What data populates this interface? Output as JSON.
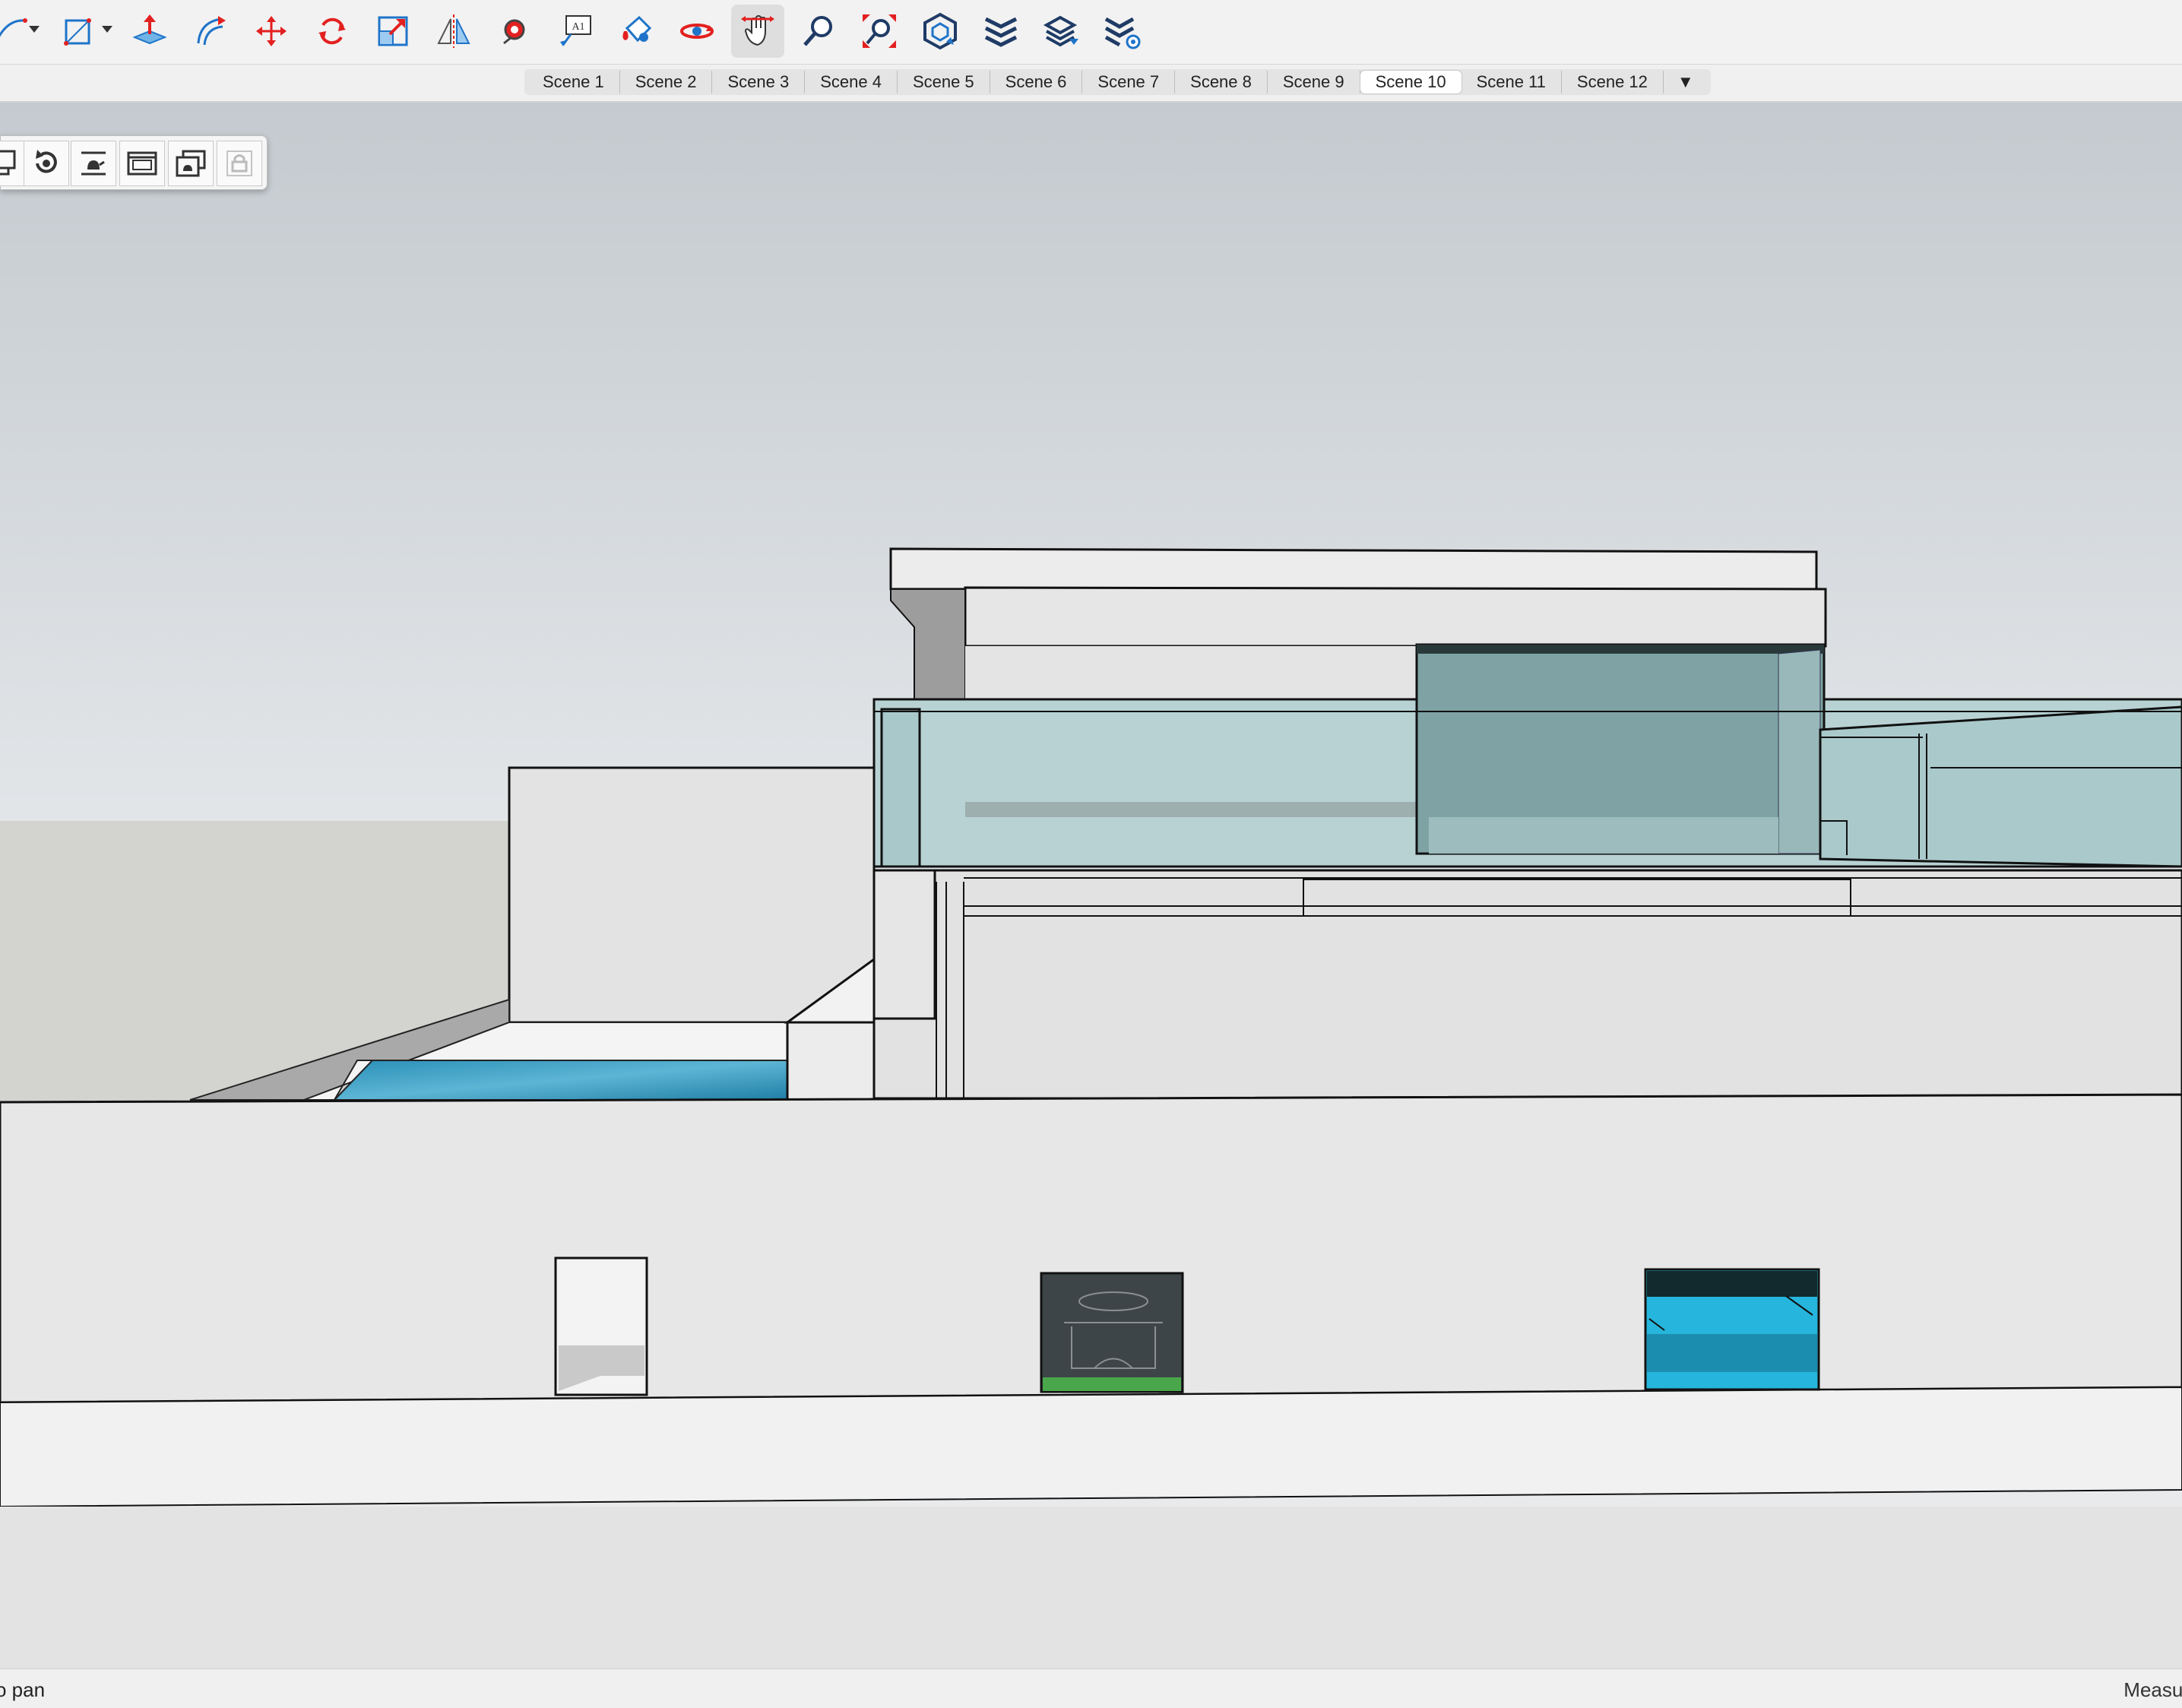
{
  "toolbar": {
    "tools": [
      {
        "name": "arc",
        "icon": "arc-pencil-icon"
      },
      {
        "name": "shapes",
        "icon": "rectangle-shape-icon"
      },
      {
        "name": "push-pull",
        "icon": "push-pull-icon"
      },
      {
        "name": "offset",
        "icon": "offset-icon"
      },
      {
        "name": "move",
        "icon": "move-icon"
      },
      {
        "name": "rotate",
        "icon": "rotate-icon"
      },
      {
        "name": "scale",
        "icon": "scale-icon"
      },
      {
        "name": "flip",
        "icon": "flip-icon"
      },
      {
        "name": "tape-measure",
        "icon": "tape-measure-icon"
      },
      {
        "name": "text",
        "icon": "text-tag-icon"
      },
      {
        "name": "paint-bucket",
        "icon": "paint-bucket-icon"
      },
      {
        "name": "orbit",
        "icon": "orbit-icon"
      },
      {
        "name": "pan",
        "icon": "pan-hand-icon",
        "active": true
      },
      {
        "name": "zoom",
        "icon": "zoom-icon"
      },
      {
        "name": "zoom-extents",
        "icon": "zoom-extents-icon"
      },
      {
        "name": "3d-warehouse",
        "icon": "warehouse-icon"
      },
      {
        "name": "extension-warehouse",
        "icon": "extension-warehouse-icon"
      },
      {
        "name": "layout",
        "icon": "send-to-layout-icon"
      },
      {
        "name": "extension-manager",
        "icon": "extension-manager-icon"
      }
    ]
  },
  "scenes": {
    "tabs": [
      "Scene 1",
      "Scene 2",
      "Scene 3",
      "Scene 4",
      "Scene 5",
      "Scene 6",
      "Scene 7",
      "Scene 8",
      "Scene 9",
      "Scene 10",
      "Scene 11",
      "Scene 12"
    ],
    "active": "Scene 10",
    "more_glyph": "▼"
  },
  "palette": {
    "buttons": [
      "copy-icon",
      "restore-icon",
      "teapot-align-icon",
      "window-frame-icon",
      "stacked-windows-icon",
      "lock-icon"
    ],
    "disabled": [
      "lock-icon"
    ]
  },
  "status": {
    "hint": "o pan",
    "measurements_label": "Measur"
  },
  "colors": {
    "accent_red": "#e32020",
    "accent_blue": "#1f74c9",
    "glass": "#a9c8c9",
    "pool": "#2f9cc4",
    "sky_top": "#c5cbd1",
    "sky_bottom": "#eceef0"
  }
}
